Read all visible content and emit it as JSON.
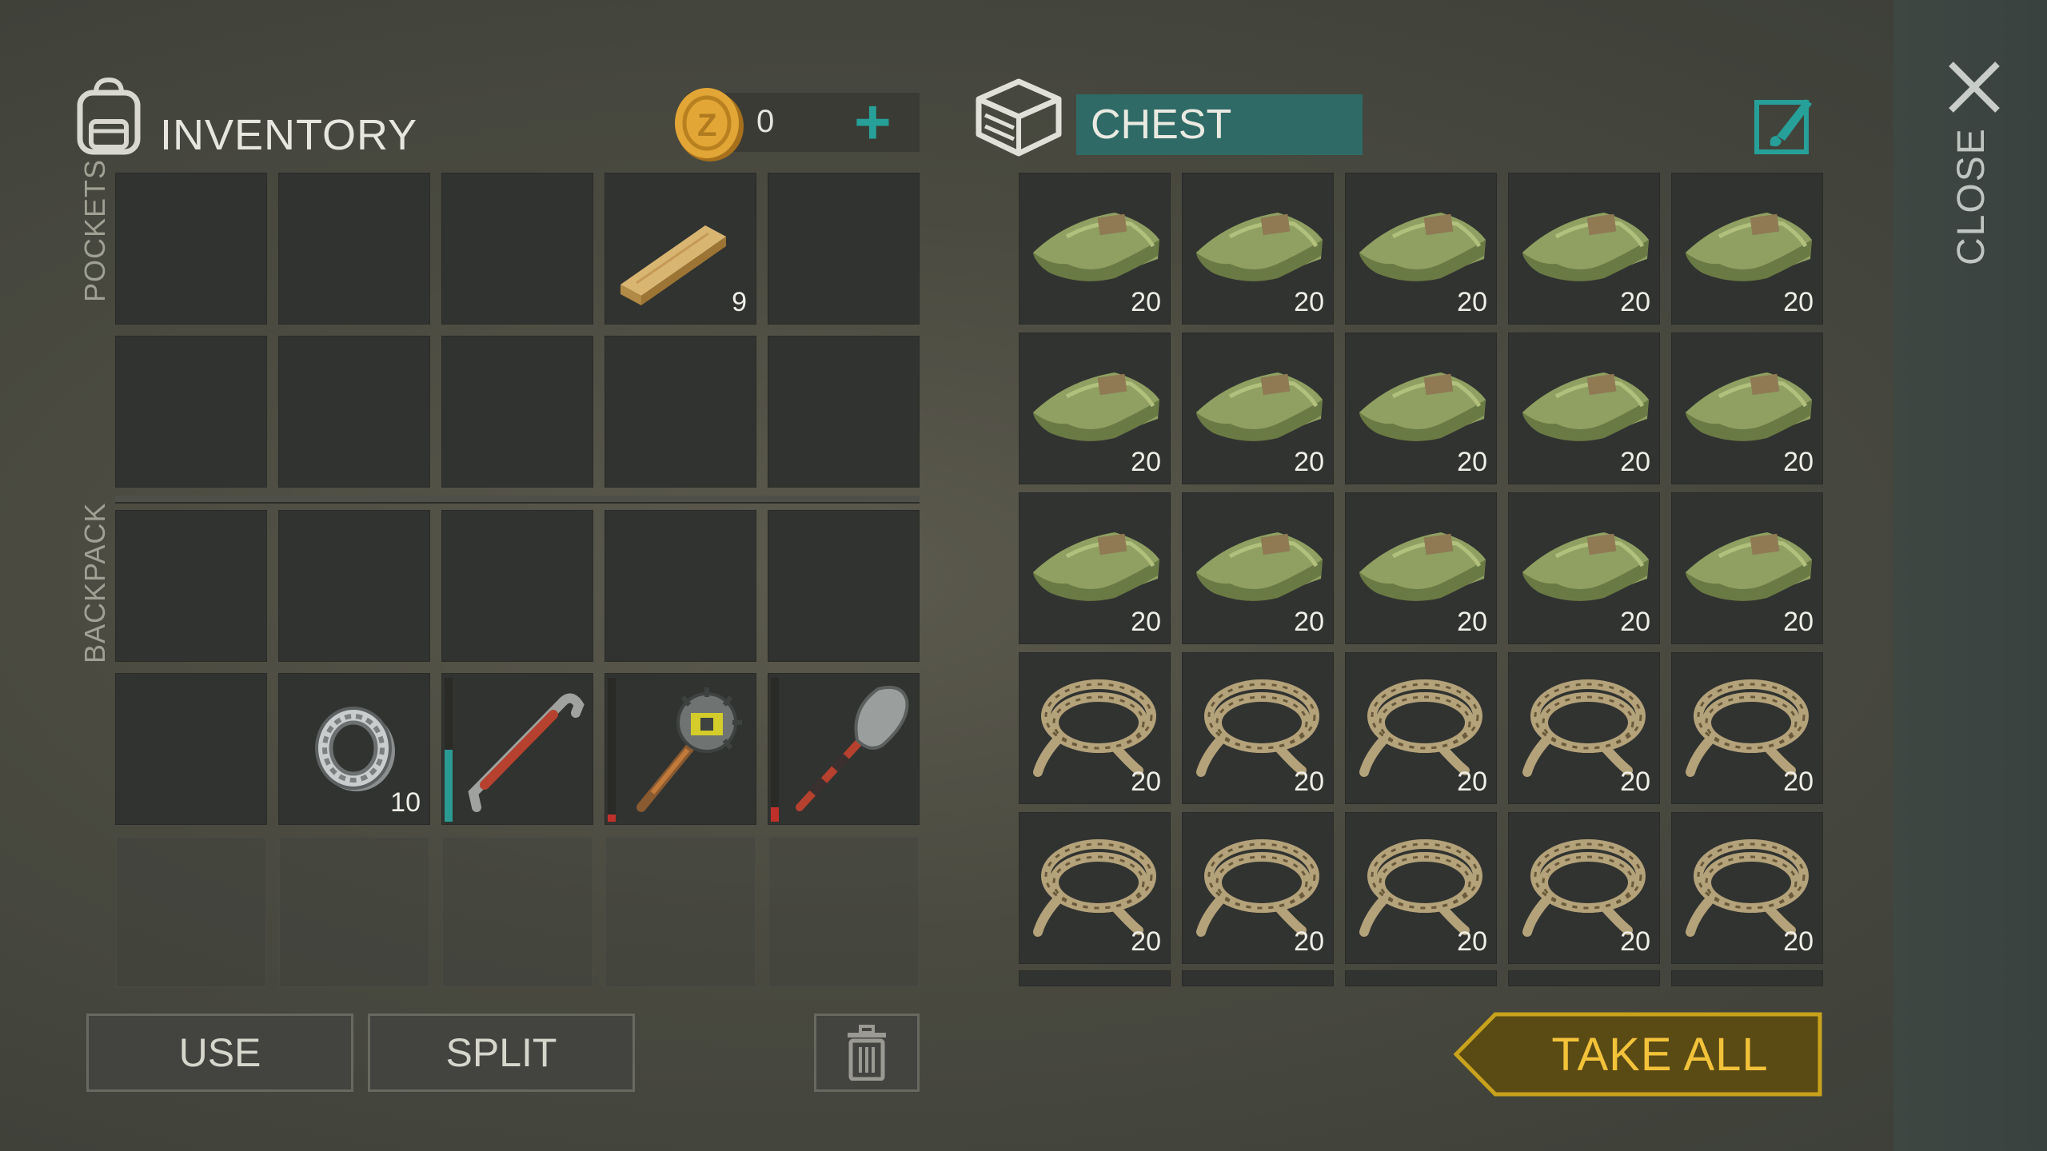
{
  "inventory": {
    "title": "INVENTORY",
    "coins": "0",
    "plus_label": "+",
    "pockets_label": "POCKETS",
    "backpack_label": "BACKPACK",
    "pockets": [
      {
        "item": "",
        "qty": ""
      },
      {
        "item": "",
        "qty": ""
      },
      {
        "item": "",
        "qty": ""
      },
      {
        "item": "wood-plank-icon",
        "qty": "9"
      },
      {
        "item": "",
        "qty": ""
      },
      {
        "item": "",
        "qty": ""
      },
      {
        "item": "",
        "qty": ""
      },
      {
        "item": "",
        "qty": ""
      },
      {
        "item": "",
        "qty": ""
      },
      {
        "item": "",
        "qty": ""
      }
    ],
    "backpack": [
      {
        "item": "",
        "qty": ""
      },
      {
        "item": "",
        "qty": ""
      },
      {
        "item": "",
        "qty": ""
      },
      {
        "item": "",
        "qty": ""
      },
      {
        "item": "",
        "qty": ""
      },
      {
        "item": "",
        "qty": ""
      },
      {
        "item": "bearing-icon",
        "qty": "10"
      },
      {
        "item": "crowbar-icon",
        "qty": "",
        "durability": 0.5,
        "durability_color": "#2a9a92"
      },
      {
        "item": "spiked-mace-icon",
        "qty": "",
        "durability": 0.05,
        "durability_color": "#c0302a"
      },
      {
        "item": "shovel-icon",
        "qty": "",
        "durability": 0.1,
        "durability_color": "#c0302a"
      }
    ]
  },
  "chest": {
    "title": "CHEST",
    "items": [
      {
        "item": "cloth-icon",
        "qty": "20"
      },
      {
        "item": "cloth-icon",
        "qty": "20"
      },
      {
        "item": "cloth-icon",
        "qty": "20"
      },
      {
        "item": "cloth-icon",
        "qty": "20"
      },
      {
        "item": "cloth-icon",
        "qty": "20"
      },
      {
        "item": "cloth-icon",
        "qty": "20"
      },
      {
        "item": "cloth-icon",
        "qty": "20"
      },
      {
        "item": "cloth-icon",
        "qty": "20"
      },
      {
        "item": "cloth-icon",
        "qty": "20"
      },
      {
        "item": "cloth-icon",
        "qty": "20"
      },
      {
        "item": "cloth-icon",
        "qty": "20"
      },
      {
        "item": "cloth-icon",
        "qty": "20"
      },
      {
        "item": "cloth-icon",
        "qty": "20"
      },
      {
        "item": "cloth-icon",
        "qty": "20"
      },
      {
        "item": "cloth-icon",
        "qty": "20"
      },
      {
        "item": "rope-icon",
        "qty": "20"
      },
      {
        "item": "rope-icon",
        "qty": "20"
      },
      {
        "item": "rope-icon",
        "qty": "20"
      },
      {
        "item": "rope-icon",
        "qty": "20"
      },
      {
        "item": "rope-icon",
        "qty": "20"
      },
      {
        "item": "rope-icon",
        "qty": "20"
      },
      {
        "item": "rope-icon",
        "qty": "20"
      },
      {
        "item": "rope-icon",
        "qty": "20"
      },
      {
        "item": "rope-icon",
        "qty": "20"
      },
      {
        "item": "rope-icon",
        "qty": "20"
      }
    ]
  },
  "buttons": {
    "use": "USE",
    "split": "SPLIT",
    "take_all": "TAKE ALL",
    "close": "CLOSE"
  },
  "colors": {
    "accent_teal": "#2a9a92",
    "take_all_gold": "#f2c33a",
    "durability_low": "#c0302a"
  }
}
